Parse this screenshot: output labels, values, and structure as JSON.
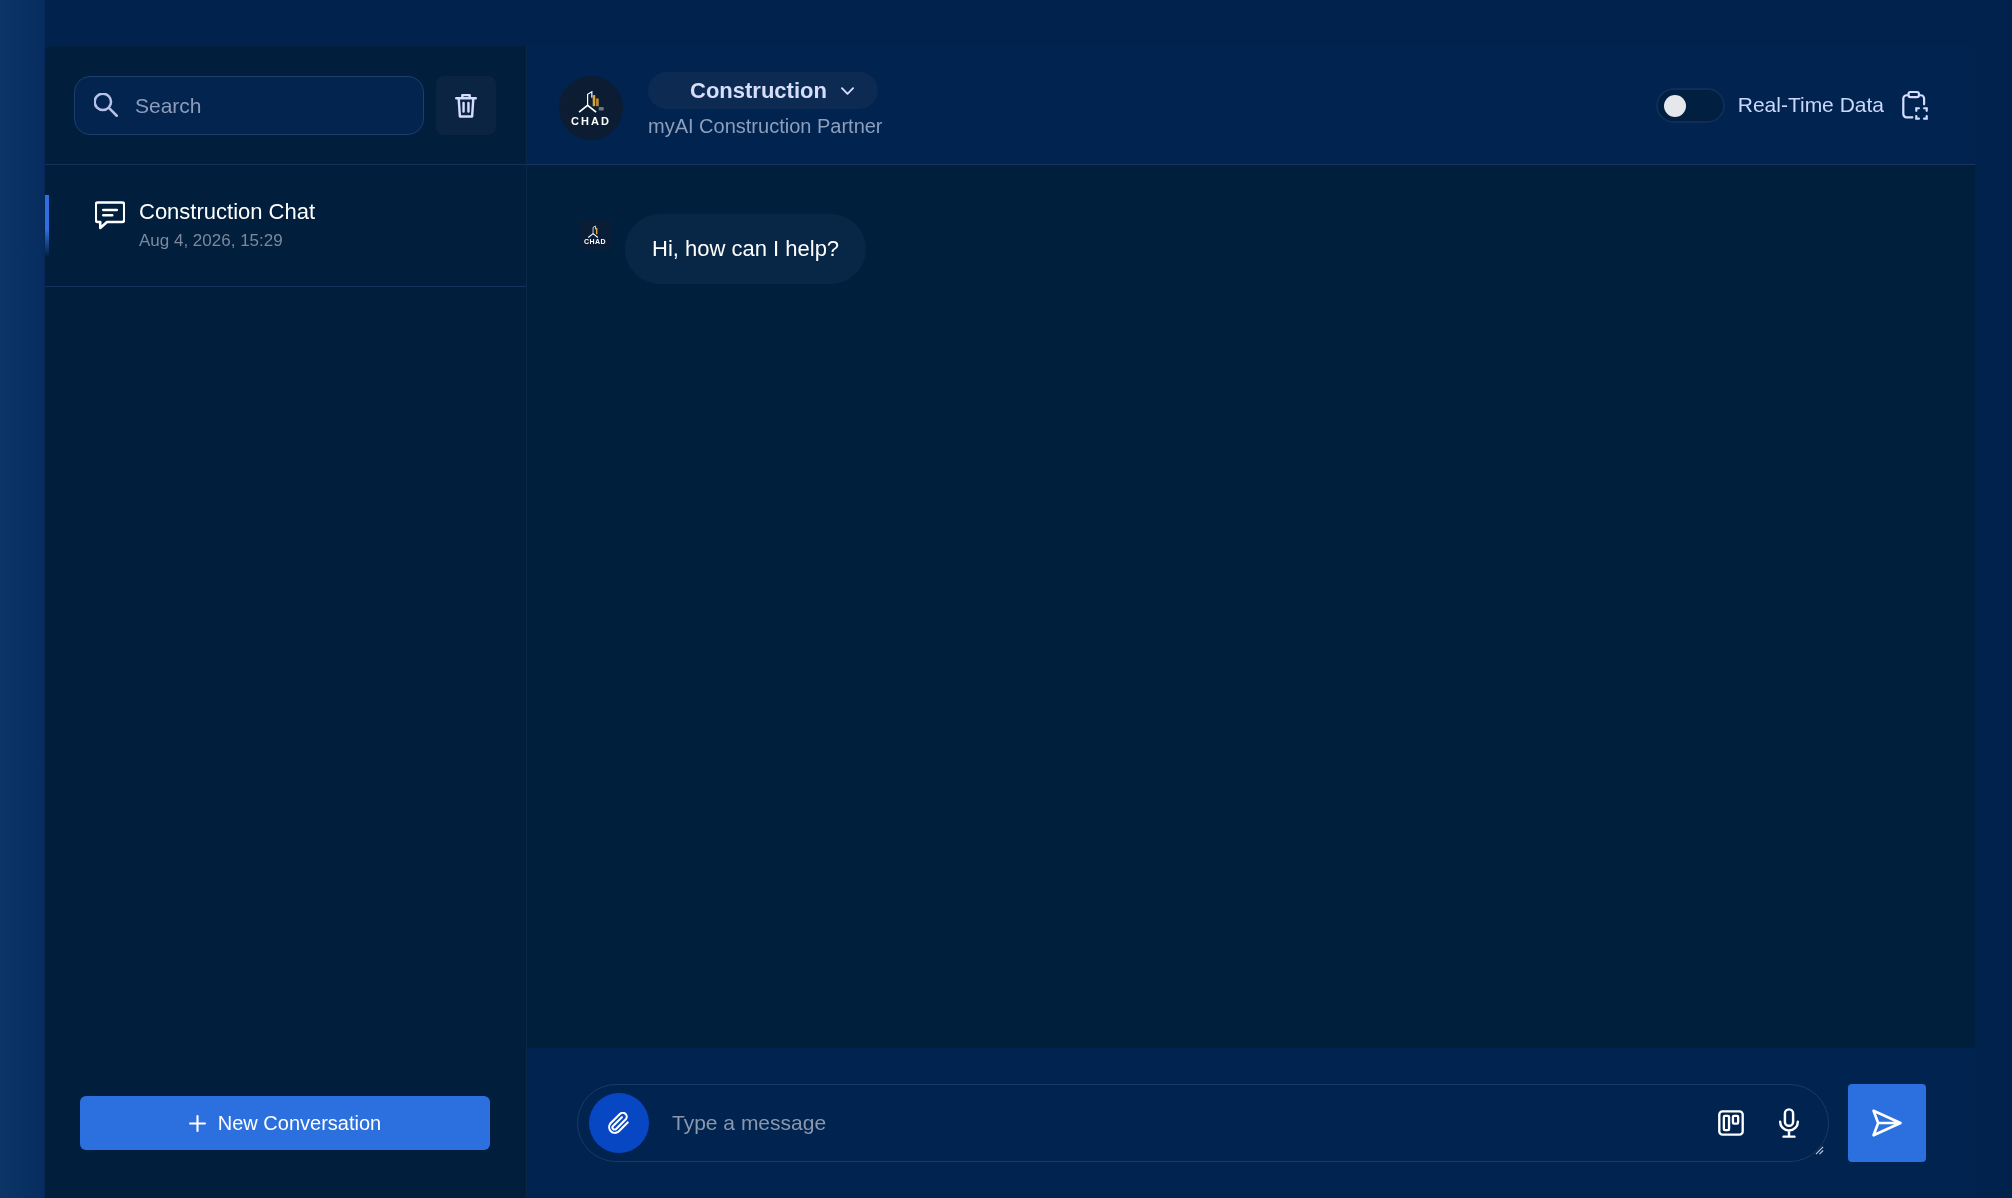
{
  "sidebar": {
    "search": {
      "placeholder": "Search"
    },
    "conversations": [
      {
        "title": "Construction Chat",
        "timestamp": "Aug 4, 2026, 15:29",
        "selected": true
      }
    ],
    "new_button": {
      "label": "New Conversation"
    }
  },
  "header": {
    "logo": {
      "name": "CHAD"
    },
    "mode_dropdown": {
      "label": "Construction"
    },
    "subtitle": "myAI Construction Partner",
    "realtime_toggle": {
      "label": "Real-Time Data",
      "on": false
    }
  },
  "messages": [
    {
      "avatar_name": "CHAD",
      "text": "Hi, how can I help?"
    }
  ],
  "composer": {
    "placeholder": "Type a message"
  }
}
